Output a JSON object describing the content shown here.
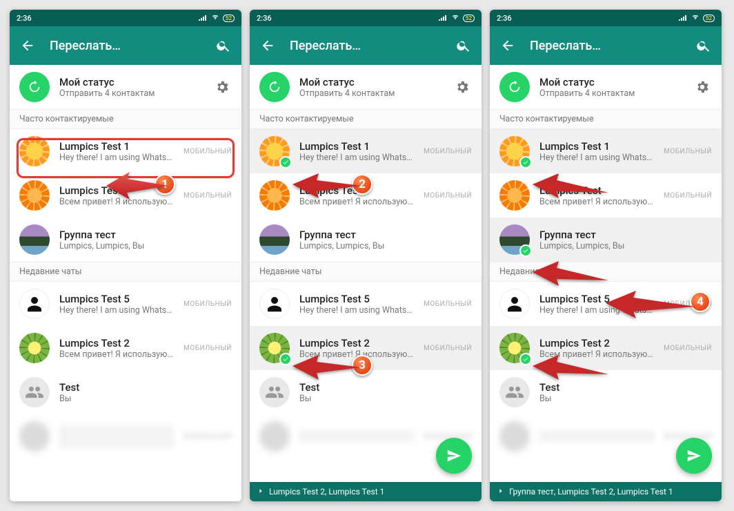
{
  "statusbar": {
    "time": "2:36",
    "battery": "52"
  },
  "appbar": {
    "title": "Переслать…"
  },
  "status_row": {
    "name": "Мой статус",
    "sub": "Отправить 4 контактам"
  },
  "sections": {
    "frequent": "Часто контактируемые",
    "recent": "Недавние чаты"
  },
  "tags": {
    "mobile": "МОБИЛЬНЫЙ"
  },
  "contacts": {
    "lt1": {
      "name": "Lumpics Test 1",
      "sub": "Hey there! I am using WhatsApp."
    },
    "lt": {
      "name": "Lumpics Test",
      "sub": "Всем привет! Я использую WhatsApp."
    },
    "grp": {
      "name": "Группа тест",
      "sub": "Lumpics, Lumpics, Вы"
    },
    "lt5": {
      "name": "Lumpics Test 5",
      "sub": "Hey there! I am using WhatsApp."
    },
    "lt2": {
      "name": "Lumpics Test 2",
      "sub": "Всем привет! Я использую WhatsApp."
    },
    "test": {
      "name": "Test",
      "sub": "Вы"
    },
    "blur": {
      "name": "XXXXX XXX",
      "sub": ""
    }
  },
  "selectedbar": {
    "p2": "Lumpics Test 2, Lumpics Test 1",
    "p3": "Группа тест, Lumpics Test 2, Lumpics Test 1"
  },
  "anno": {
    "b1": "1",
    "b2": "2",
    "b3": "3",
    "b4": "4"
  }
}
